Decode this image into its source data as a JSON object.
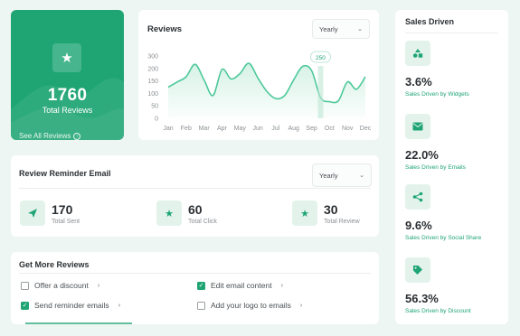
{
  "total_reviews": {
    "value": "1760",
    "label": "Total Reviews",
    "see_all": "See All Reviews",
    "icon": "star-icon"
  },
  "reviews_chart": {
    "title": "Reviews",
    "period": "Yearly",
    "tooltip": "250"
  },
  "chart_data": {
    "type": "area",
    "title": "Reviews",
    "categories": [
      "Jan",
      "Feb",
      "Mar",
      "Apr",
      "May",
      "Jun",
      "Jul",
      "Aug",
      "Sep",
      "Oct",
      "Nov",
      "Dec"
    ],
    "y_ticks": [
      "300",
      "200",
      "150",
      "100",
      "50",
      "0"
    ],
    "ylim": [
      0,
      300
    ],
    "series": [
      {
        "x": [
          0,
          0.5,
          1,
          1.5,
          2,
          2.5,
          3,
          3.5,
          4,
          4.5,
          5,
          5.5,
          6,
          6.5,
          7,
          7.5,
          8,
          8.5,
          9,
          9.5,
          10,
          10.5,
          11
        ],
        "values": [
          150,
          175,
          200,
          260,
          185,
          110,
          235,
          190,
          215,
          265,
          195,
          130,
          95,
          110,
          185,
          250,
          230,
          100,
          80,
          85,
          175,
          140,
          200
        ]
      }
    ],
    "highlight": {
      "x": 8.5,
      "label": "250"
    },
    "colors": {
      "line": "#4cc99a",
      "fill": "#d6f2e6"
    },
    "grid": false
  },
  "reminder": {
    "title": "Review Reminder Email",
    "period": "Yearly",
    "stats": [
      {
        "value": "170",
        "label": "Total Sent",
        "icon": "send-icon"
      },
      {
        "value": "60",
        "label": "Total Click",
        "icon": "star-icon"
      },
      {
        "value": "30",
        "label": "Total Review",
        "icon": "star-icon"
      }
    ]
  },
  "get_more": {
    "title": "Get More Reviews",
    "options": [
      {
        "label": "Offer a discount",
        "checked": false
      },
      {
        "label": "Edit email content",
        "checked": true
      },
      {
        "label": "Send reminder emails",
        "checked": true
      },
      {
        "label": "Add your logo to emails",
        "checked": false
      }
    ]
  },
  "sales": {
    "title": "Sales Driven",
    "items": [
      {
        "value": "3.6%",
        "label": "Sales Driven by Widgets",
        "icon": "shapes-icon"
      },
      {
        "value": "22.0%",
        "label": "Sales Driven by Emails",
        "icon": "mail-icon"
      },
      {
        "value": "9.6%",
        "label": "Sales Driven by Social Share",
        "icon": "share-icon"
      },
      {
        "value": "56.3%",
        "label": "Sales Driven by Discount",
        "icon": "tag-icon"
      }
    ]
  },
  "colors": {
    "accent": "#1fa574",
    "background": "#eef6f3"
  }
}
